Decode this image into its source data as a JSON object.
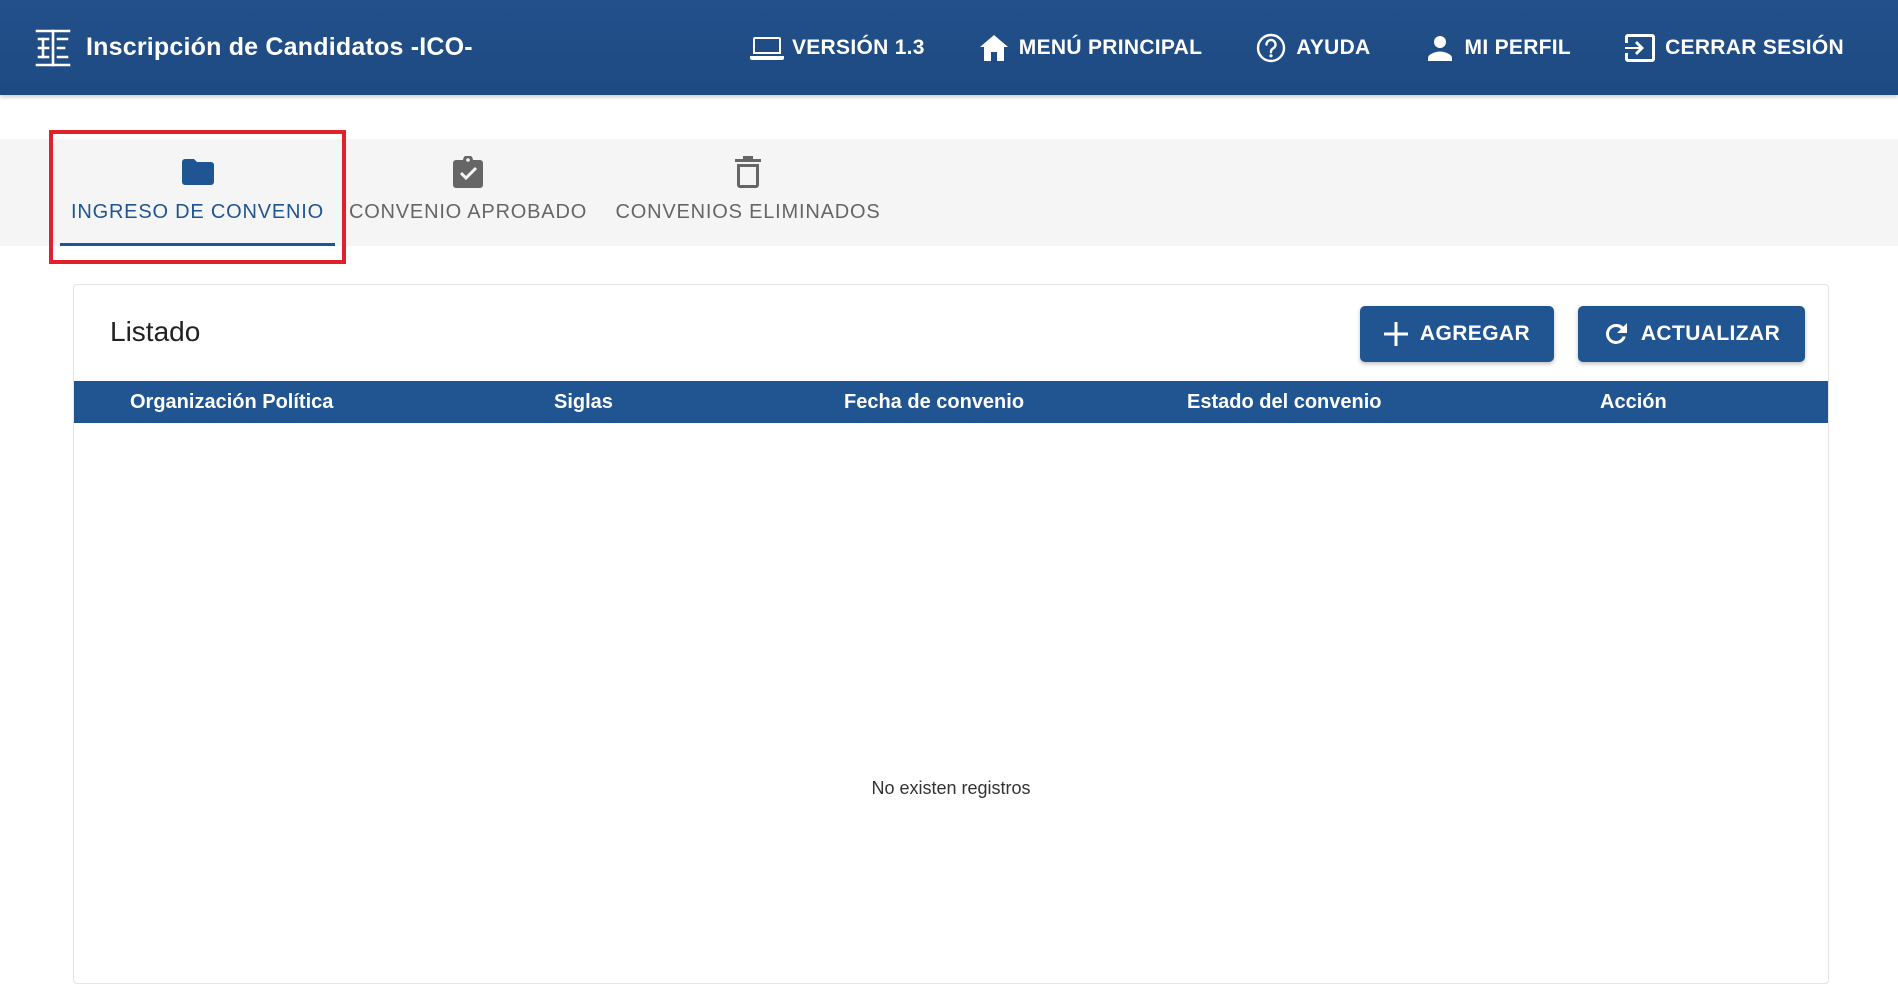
{
  "header": {
    "title": "Inscripción de Candidatos -ICO-",
    "logo_icon": "te-logo-icon",
    "nav": [
      {
        "label": "VERSIÓN 1.3",
        "icon": "laptop-icon"
      },
      {
        "label": "MENÚ PRINCIPAL",
        "icon": "home-icon"
      },
      {
        "label": "AYUDA",
        "icon": "help-circle-icon"
      },
      {
        "label": "MI PERFIL",
        "icon": "person-icon"
      },
      {
        "label": "CERRAR SESIÓN",
        "icon": "logout-icon"
      }
    ]
  },
  "tabs": [
    {
      "label": "INGRESO DE CONVENIO",
      "icon": "folder-icon",
      "active": true
    },
    {
      "label": "CONVENIO APROBADO",
      "icon": "clipboard-check-icon",
      "active": false
    },
    {
      "label": "CONVENIOS ELIMINADOS",
      "icon": "trash-icon",
      "active": false
    }
  ],
  "card": {
    "title": "Listado",
    "add_label": "AGREGAR",
    "refresh_label": "ACTUALIZAR",
    "columns": [
      "Organización Política",
      "Siglas",
      "Fecha de convenio",
      "Estado del convenio",
      "Acción"
    ],
    "rows": [],
    "empty_message": "No existen registros"
  },
  "colors": {
    "primary": "#215592",
    "highlight": "#e0202a",
    "tab_bar_bg": "#f5f5f5"
  }
}
